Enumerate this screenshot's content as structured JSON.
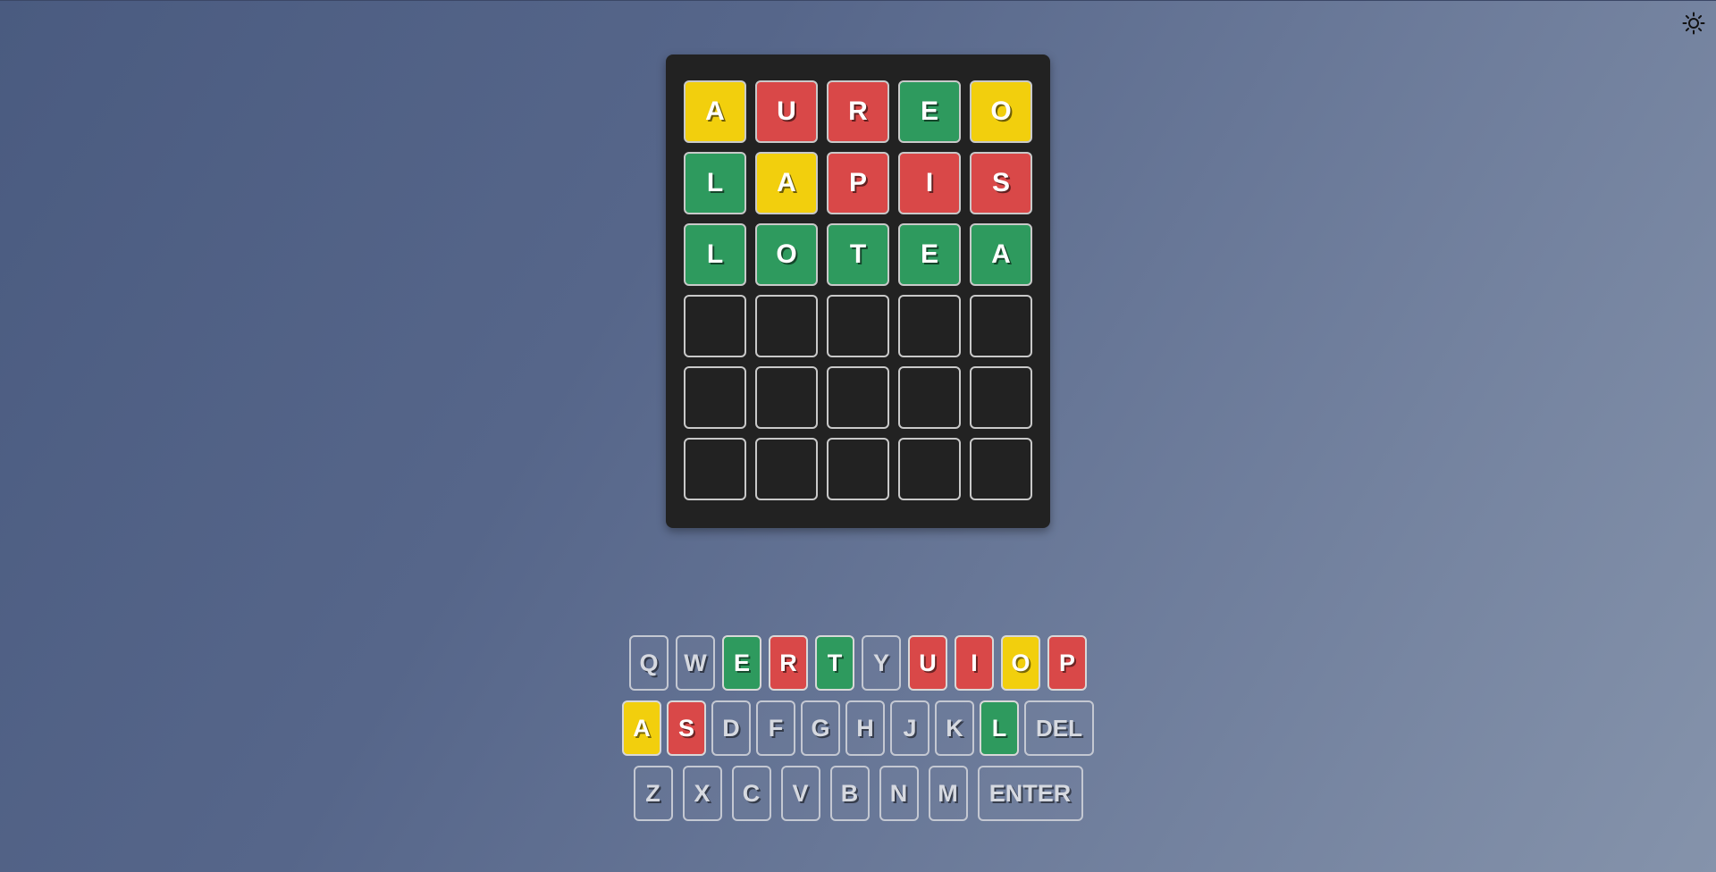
{
  "colors": {
    "correct": "#2e9a5e",
    "present": "#f2cf0d",
    "absent": "#d94848",
    "empty": "#222222",
    "unused": "rgba(120,132,160,0.25)"
  },
  "theme_toggle": {
    "icon": "sun-icon"
  },
  "board": {
    "rows": [
      [
        {
          "letter": "A",
          "state": "present"
        },
        {
          "letter": "U",
          "state": "absent"
        },
        {
          "letter": "R",
          "state": "absent"
        },
        {
          "letter": "E",
          "state": "correct"
        },
        {
          "letter": "O",
          "state": "present"
        }
      ],
      [
        {
          "letter": "L",
          "state": "correct"
        },
        {
          "letter": "A",
          "state": "present"
        },
        {
          "letter": "P",
          "state": "absent"
        },
        {
          "letter": "I",
          "state": "absent"
        },
        {
          "letter": "S",
          "state": "absent"
        }
      ],
      [
        {
          "letter": "L",
          "state": "correct"
        },
        {
          "letter": "O",
          "state": "correct"
        },
        {
          "letter": "T",
          "state": "correct"
        },
        {
          "letter": "E",
          "state": "correct"
        },
        {
          "letter": "A",
          "state": "correct"
        }
      ],
      [
        {
          "letter": "",
          "state": "empty"
        },
        {
          "letter": "",
          "state": "empty"
        },
        {
          "letter": "",
          "state": "empty"
        },
        {
          "letter": "",
          "state": "empty"
        },
        {
          "letter": "",
          "state": "empty"
        }
      ],
      [
        {
          "letter": "",
          "state": "empty"
        },
        {
          "letter": "",
          "state": "empty"
        },
        {
          "letter": "",
          "state": "empty"
        },
        {
          "letter": "",
          "state": "empty"
        },
        {
          "letter": "",
          "state": "empty"
        }
      ],
      [
        {
          "letter": "",
          "state": "empty"
        },
        {
          "letter": "",
          "state": "empty"
        },
        {
          "letter": "",
          "state": "empty"
        },
        {
          "letter": "",
          "state": "empty"
        },
        {
          "letter": "",
          "state": "empty"
        }
      ]
    ]
  },
  "keyboard": {
    "rows": [
      [
        {
          "label": "Q",
          "state": "unused"
        },
        {
          "label": "W",
          "state": "unused"
        },
        {
          "label": "E",
          "state": "correct"
        },
        {
          "label": "R",
          "state": "absent"
        },
        {
          "label": "T",
          "state": "correct"
        },
        {
          "label": "Y",
          "state": "unused"
        },
        {
          "label": "U",
          "state": "absent"
        },
        {
          "label": "I",
          "state": "absent"
        },
        {
          "label": "O",
          "state": "present"
        },
        {
          "label": "P",
          "state": "absent"
        }
      ],
      [
        {
          "label": "A",
          "state": "present"
        },
        {
          "label": "S",
          "state": "absent"
        },
        {
          "label": "D",
          "state": "unused"
        },
        {
          "label": "F",
          "state": "unused"
        },
        {
          "label": "G",
          "state": "unused"
        },
        {
          "label": "H",
          "state": "unused"
        },
        {
          "label": "J",
          "state": "unused"
        },
        {
          "label": "K",
          "state": "unused"
        },
        {
          "label": "L",
          "state": "correct"
        },
        {
          "label": "DEL",
          "state": "unused",
          "kind": "del"
        }
      ],
      [
        {
          "label": "Z",
          "state": "unused"
        },
        {
          "label": "X",
          "state": "unused"
        },
        {
          "label": "C",
          "state": "unused"
        },
        {
          "label": "V",
          "state": "unused"
        },
        {
          "label": "B",
          "state": "unused"
        },
        {
          "label": "N",
          "state": "unused"
        },
        {
          "label": "M",
          "state": "unused"
        },
        {
          "label": "ENTER",
          "state": "unused",
          "kind": "enter"
        }
      ]
    ]
  }
}
